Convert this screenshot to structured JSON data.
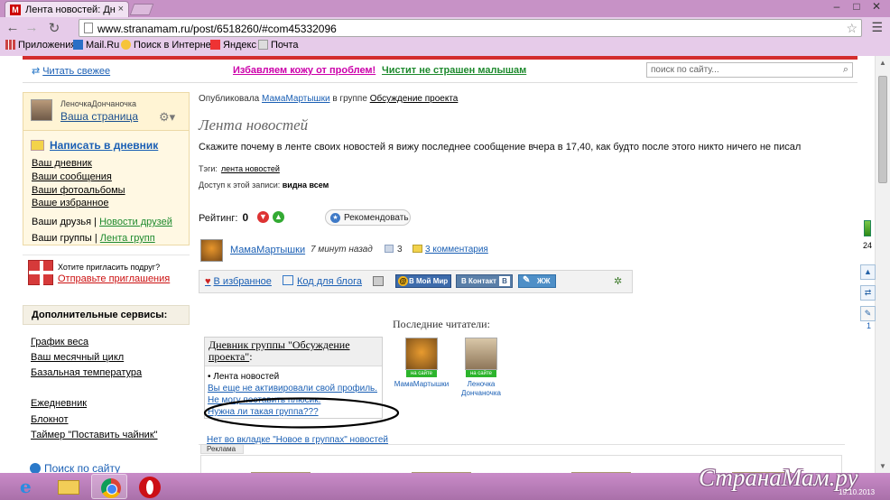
{
  "browser": {
    "tab_title": "Лента новостей: Дневни",
    "tab_favicon": "M",
    "url": "www.stranamam.ru/post/6518260/#com45332096",
    "bookmarks": [
      {
        "label": "Приложения",
        "icon": "apps-grid-icon"
      },
      {
        "label": "Mail.Ru",
        "icon": "mailru-icon"
      },
      {
        "label": "Поиск в Интернете",
        "icon": "search-web-icon"
      },
      {
        "label": "Яндекс",
        "icon": "yandex-icon"
      },
      {
        "label": "Почта",
        "icon": "mail-icon"
      }
    ]
  },
  "topbar": {
    "refresh_link": "Читать свежее",
    "promo1": "Избавляем кожу от проблем!",
    "promo2": "Чистит не страшен малышам",
    "search_placeholder": "поиск по сайту..."
  },
  "sidebar": {
    "user_name": "ЛеночкаДончаночка",
    "your_page": "Ваша страница",
    "write_link": "Написать в дневник",
    "links": [
      "Ваш дневник",
      "Ваши сообщения",
      "Ваши фотоальбомы",
      "Ваше избранное"
    ],
    "friends": "Ваши друзья",
    "friends_news": "Новости друзей",
    "groups": "Ваши группы",
    "groups_feed": "Лента групп",
    "invite_question": "Хотите пригласить подруг?",
    "invite_action": "Отправьте приглашения",
    "extra_title": "Дополнительные сервисы:",
    "extra_links": [
      "График веса",
      "Ваш месячный цикл",
      "Базальная температура"
    ],
    "extra_links2": [
      "Ежедневник",
      "Блокнот",
      "Таймер \"Поставить чайник\""
    ],
    "search_link": "Поиск по сайту"
  },
  "post": {
    "published_by": "Опубликовала",
    "author": "МамаМартышки",
    "in_group": "в группе",
    "group": "Обсуждение проекта",
    "title": "Лента новостей",
    "body": "Скажите почему в ленте своих новостей я вижу последнее сообщение вчера в 17,40, как будто после этого никто ничего не писал",
    "tags_label": "Тэги:",
    "tag": "лента новостей",
    "access_label": "Доступ к этой записи:",
    "access_value": "видна всем",
    "rating_label": "Рейтинг:",
    "rating": "0",
    "recommend": "Рекомендовать",
    "time": "7 минут назад",
    "views": "3",
    "comments": "3 комментария"
  },
  "actions": {
    "favorite": "В избранное",
    "blog_code": "Код для блога",
    "moi_mir": "В Мой Мир",
    "vkontakte": "В Контакт",
    "vk_badge": "В",
    "lj": "ЖЖ"
  },
  "group_box": {
    "title_link": "Дневник группы \"Обсуждение проекта\"",
    "title_suffix": ":",
    "items": [
      {
        "text": "• Лента новостей",
        "link": false
      },
      {
        "text": "Вы еще не активировали свой профиль.",
        "link": true
      },
      {
        "text": "Не могу поставить плюсик.",
        "link": true
      },
      {
        "text": "Нужна ли такая группа???",
        "link": true
      },
      {
        "text": "Нет во вкладке \"Новое в группах\" новостей",
        "link": true
      }
    ]
  },
  "readers": {
    "title": "Последние читатели:",
    "list": [
      {
        "name": "МамаМартышки",
        "status": "на сайте"
      },
      {
        "name": "Леночка Дончаночка",
        "status": "на сайте"
      }
    ]
  },
  "ad_label": "Реклама",
  "side_panel": {
    "count": "24",
    "badge": "1"
  },
  "watermark": "СтранаМам.ру",
  "clock": "19.10.2013"
}
